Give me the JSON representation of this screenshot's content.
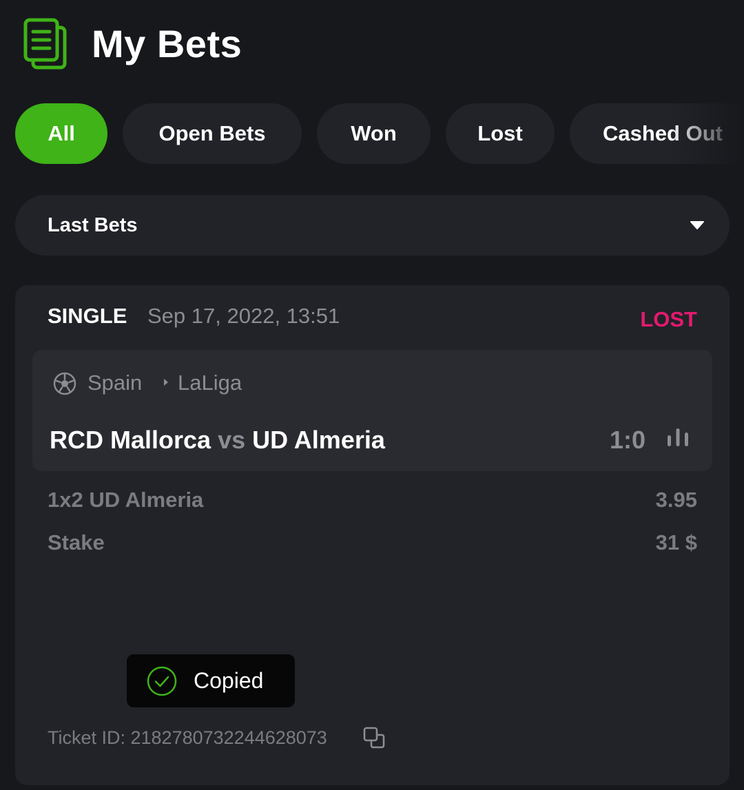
{
  "header": {
    "title": "My Bets",
    "icon": "bet-slip-icon",
    "accent_color": "#3fb318"
  },
  "tabs": [
    {
      "label": "All",
      "active": true
    },
    {
      "label": "Open Bets",
      "active": false
    },
    {
      "label": "Won",
      "active": false
    },
    {
      "label": "Lost",
      "active": false
    },
    {
      "label": "Cashed Out",
      "active": false
    }
  ],
  "filter": {
    "selected": "Last Bets",
    "icon": "chevron-down-icon"
  },
  "bet": {
    "type": "SINGLE",
    "date": "Sep 17, 2022, 13:51",
    "status": "LOST",
    "status_color": "#e5196f",
    "event": {
      "sport_icon": "soccer-ball-icon",
      "country": "Spain",
      "league": "LaLiga",
      "home_team": "RCD Mallorca",
      "vs": "vs",
      "away_team": "UD Almeria",
      "score": "1:0",
      "stats_icon": "stats-icon"
    },
    "selection": {
      "label": "1x2 UD Almeria",
      "odds": "3.95"
    },
    "stake": {
      "label": "Stake",
      "value": "31 $"
    },
    "ticket": {
      "text": "Ticket ID: 2182780732244628073",
      "copy_icon": "copy-icon"
    }
  },
  "toast": {
    "text": "Copied",
    "icon": "check-circle-icon"
  }
}
